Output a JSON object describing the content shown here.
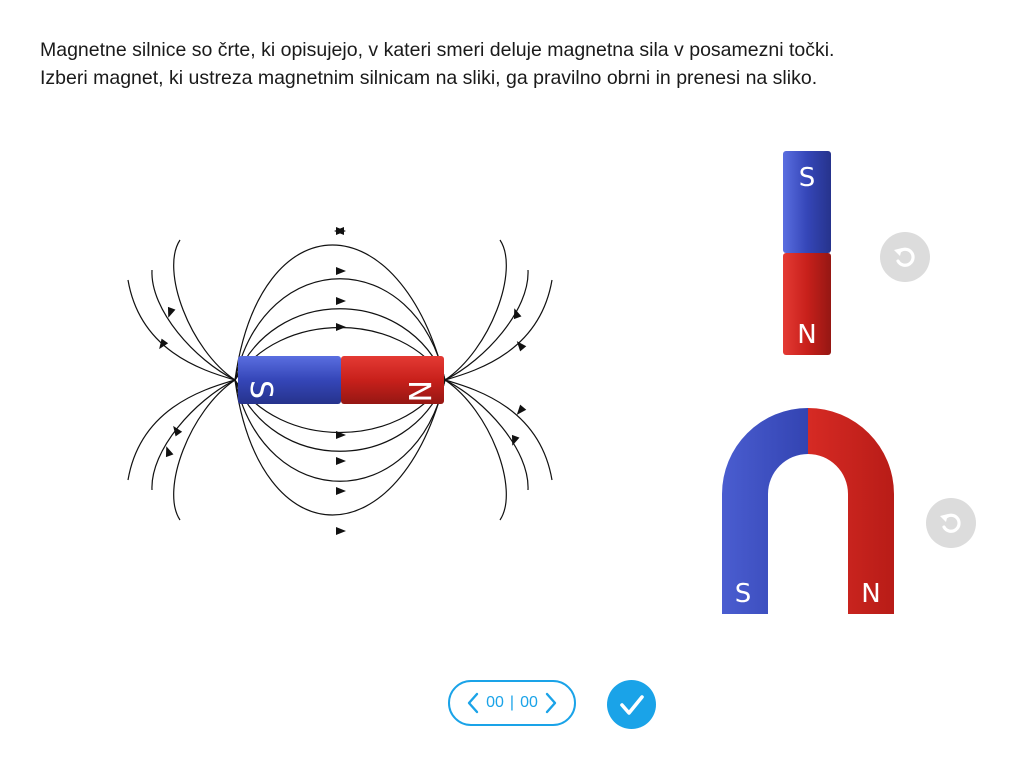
{
  "instructions": {
    "line1": "Magnetne silnice so črte, ki opisujejo, v kateri smeri deluje magnetna sila v posamezni točki.",
    "line2": "Izberi magnet, ki ustreza magnetnim silnicam na sliki, ga pravilno obrni in prenesi na sliko."
  },
  "figure": {
    "bar_magnet": {
      "left_pole": "S",
      "right_pole": "N"
    }
  },
  "options": {
    "bar_magnet": {
      "top_pole": "S",
      "bottom_pole": "N",
      "rotate_icon": "rotate-left-icon"
    },
    "horseshoe_magnet": {
      "left_pole": "S",
      "right_pole": "N",
      "rotate_icon": "rotate-left-icon"
    }
  },
  "pager": {
    "current": "00",
    "separator": "|",
    "total": "00",
    "prev_icon": "chevron-left-icon",
    "next_icon": "chevron-right-icon"
  },
  "check_icon": "check-icon",
  "colors": {
    "north_red": "#c8201b",
    "south_blue": "#3546b8",
    "accent": "#1aa3e8",
    "rotate_gray": "#dcdcdc"
  }
}
